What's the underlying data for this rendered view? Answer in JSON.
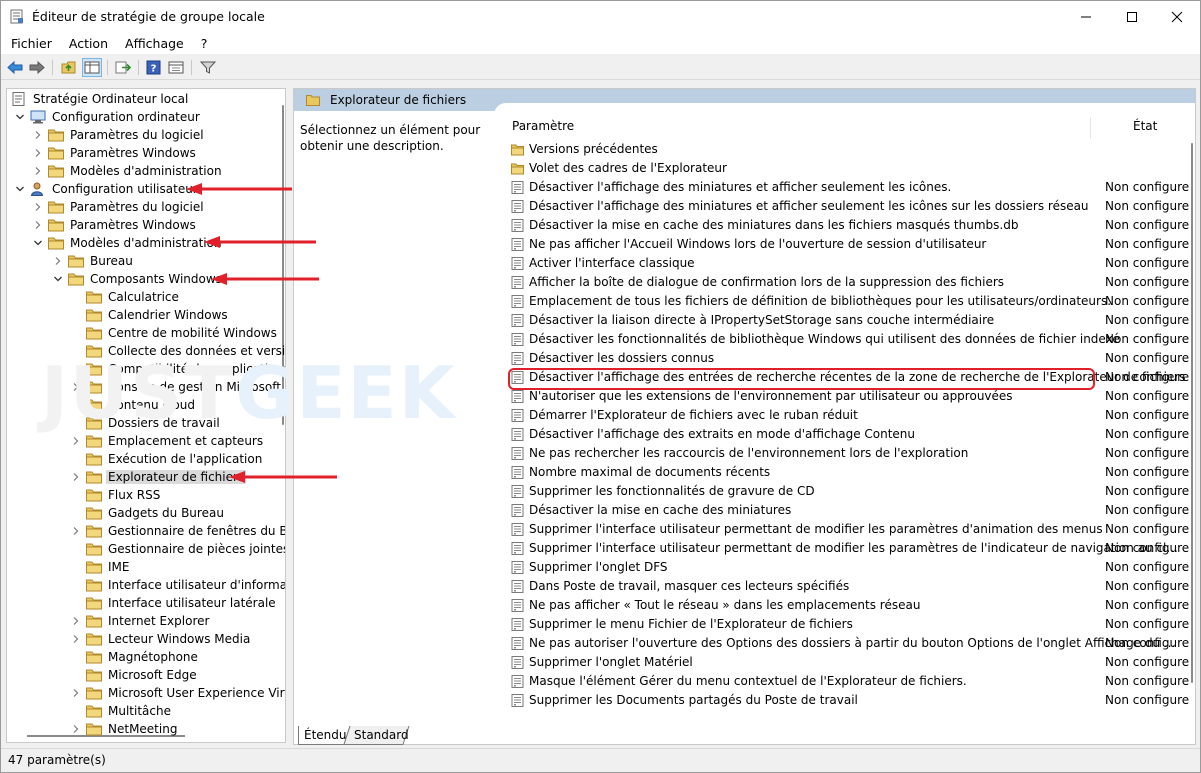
{
  "window": {
    "title": "Éditeur de stratégie de groupe locale",
    "menu": [
      "Fichier",
      "Action",
      "Affichage",
      "?"
    ]
  },
  "tree": [
    {
      "label": "Stratégie Ordinateur local",
      "indent": 0,
      "chev": "",
      "icon": "policy",
      "sel": false
    },
    {
      "label": "Configuration ordinateur",
      "indent": 1,
      "chev": "down",
      "icon": "computer",
      "sel": false
    },
    {
      "label": "Paramètres du logiciel",
      "indent": 2,
      "chev": "right",
      "icon": "folder",
      "sel": false
    },
    {
      "label": "Paramètres Windows",
      "indent": 2,
      "chev": "right",
      "icon": "folder",
      "sel": false
    },
    {
      "label": "Modèles d'administration",
      "indent": 2,
      "chev": "right",
      "icon": "folder",
      "sel": false
    },
    {
      "label": "Configuration utilisateur",
      "indent": 1,
      "chev": "down",
      "icon": "user",
      "sel": false
    },
    {
      "label": "Paramètres du logiciel",
      "indent": 2,
      "chev": "right",
      "icon": "folder",
      "sel": false
    },
    {
      "label": "Paramètres Windows",
      "indent": 2,
      "chev": "right",
      "icon": "folder",
      "sel": false
    },
    {
      "label": "Modèles d'administration",
      "indent": 2,
      "chev": "down",
      "icon": "folder",
      "sel": false
    },
    {
      "label": "Bureau",
      "indent": 3,
      "chev": "right",
      "icon": "folder",
      "sel": false
    },
    {
      "label": "Composants Windows",
      "indent": 3,
      "chev": "down",
      "icon": "folder",
      "sel": false
    },
    {
      "label": "Calculatrice",
      "indent": 4,
      "chev": "",
      "icon": "folder",
      "sel": false
    },
    {
      "label": "Calendrier Windows",
      "indent": 4,
      "chev": "",
      "icon": "folder",
      "sel": false
    },
    {
      "label": "Centre de mobilité Windows",
      "indent": 4,
      "chev": "",
      "icon": "folder",
      "sel": false
    },
    {
      "label": "Collecte des données et version",
      "indent": 4,
      "chev": "",
      "icon": "folder",
      "sel": false
    },
    {
      "label": "Compatibilité des applications",
      "indent": 4,
      "chev": "",
      "icon": "folder",
      "sel": false
    },
    {
      "label": "Console de gestion Microsoft",
      "indent": 4,
      "chev": "right",
      "icon": "folder",
      "sel": false
    },
    {
      "label": "Contenu cloud",
      "indent": 4,
      "chev": "",
      "icon": "folder",
      "sel": false
    },
    {
      "label": "Dossiers de travail",
      "indent": 4,
      "chev": "",
      "icon": "folder",
      "sel": false
    },
    {
      "label": "Emplacement et capteurs",
      "indent": 4,
      "chev": "right",
      "icon": "folder",
      "sel": false
    },
    {
      "label": "Exécution de l'application",
      "indent": 4,
      "chev": "",
      "icon": "folder",
      "sel": false
    },
    {
      "label": "Explorateur de fichiers",
      "indent": 4,
      "chev": "right",
      "icon": "folder",
      "sel": true
    },
    {
      "label": "Flux RSS",
      "indent": 4,
      "chev": "",
      "icon": "folder",
      "sel": false
    },
    {
      "label": "Gadgets du Bureau",
      "indent": 4,
      "chev": "",
      "icon": "folder",
      "sel": false
    },
    {
      "label": "Gestionnaire de fenêtres du Bu",
      "indent": 4,
      "chev": "right",
      "icon": "folder",
      "sel": false
    },
    {
      "label": "Gestionnaire de pièces jointes",
      "indent": 4,
      "chev": "",
      "icon": "folder",
      "sel": false
    },
    {
      "label": "IME",
      "indent": 4,
      "chev": "",
      "icon": "folder",
      "sel": false
    },
    {
      "label": "Interface utilisateur d'informati",
      "indent": 4,
      "chev": "",
      "icon": "folder",
      "sel": false
    },
    {
      "label": "Interface utilisateur latérale",
      "indent": 4,
      "chev": "",
      "icon": "folder",
      "sel": false
    },
    {
      "label": "Internet Explorer",
      "indent": 4,
      "chev": "right",
      "icon": "folder",
      "sel": false
    },
    {
      "label": "Lecteur Windows Media",
      "indent": 4,
      "chev": "right",
      "icon": "folder",
      "sel": false
    },
    {
      "label": "Magnétophone",
      "indent": 4,
      "chev": "",
      "icon": "folder",
      "sel": false
    },
    {
      "label": "Microsoft Edge",
      "indent": 4,
      "chev": "",
      "icon": "folder",
      "sel": false
    },
    {
      "label": "Microsoft User Experience Virtu",
      "indent": 4,
      "chev": "right",
      "icon": "folder",
      "sel": false
    },
    {
      "label": "Multitâche",
      "indent": 4,
      "chev": "",
      "icon": "folder",
      "sel": false
    },
    {
      "label": "NetMeeting",
      "indent": 4,
      "chev": "right",
      "icon": "folder",
      "sel": false
    }
  ],
  "panel": {
    "header": "Explorateur de fichiers",
    "description": "Sélectionnez un élément pour obtenir une description.",
    "col_param": "Paramètre",
    "col_state": "État"
  },
  "settings": [
    {
      "name": "Versions précédentes",
      "state": "",
      "folder": true
    },
    {
      "name": "Volet des cadres de l'Explorateur",
      "state": "",
      "folder": true
    },
    {
      "name": "Désactiver l'affichage des miniatures et afficher seulement les icônes.",
      "state": "Non configure",
      "folder": false
    },
    {
      "name": "Désactiver l'affichage des miniatures et afficher seulement les icônes sur les dossiers réseau",
      "state": "Non configure",
      "folder": false
    },
    {
      "name": "Désactiver la mise en cache des miniatures dans les fichiers masqués thumbs.db",
      "state": "Non configure",
      "folder": false
    },
    {
      "name": "Ne pas afficher l'Accueil Windows lors de l'ouverture de session d'utilisateur",
      "state": "Non configure",
      "folder": false
    },
    {
      "name": "Activer l'interface classique",
      "state": "Non configure",
      "folder": false
    },
    {
      "name": "Afficher la boîte de dialogue de confirmation lors de la suppression des fichiers",
      "state": "Non configure",
      "folder": false
    },
    {
      "name": "Emplacement de tous les fichiers de définition de bibliothèques pour les utilisateurs/ordinateurs.",
      "state": "Non configure",
      "folder": false
    },
    {
      "name": "Désactiver la liaison directe à IPropertySetStorage sans couche intermédiaire",
      "state": "Non configure",
      "folder": false
    },
    {
      "name": "Désactiver les fonctionnalités de bibliothèque Windows qui utilisent des données de fichier indexé",
      "state": "Non configure",
      "folder": false
    },
    {
      "name": "Désactiver les dossiers connus",
      "state": "Non configure",
      "folder": false
    },
    {
      "name": "Désactiver l'affichage des entrées de recherche récentes de la zone de recherche de l'Explorateur de fichiers",
      "state": "Non configure",
      "folder": false
    },
    {
      "name": "N'autoriser que les extensions de l'environnement par utilisateur ou approuvées",
      "state": "Non configure",
      "folder": false
    },
    {
      "name": "Démarrer l'Explorateur de fichiers avec le ruban réduit",
      "state": "Non configure",
      "folder": false
    },
    {
      "name": "Désactiver l'affichage des extraits en mode d'affichage Contenu",
      "state": "Non configure",
      "folder": false
    },
    {
      "name": "Ne pas rechercher les raccourcis de l'environnement lors de l'exploration",
      "state": "Non configure",
      "folder": false
    },
    {
      "name": "Nombre maximal de documents récents",
      "state": "Non configure",
      "folder": false
    },
    {
      "name": "Supprimer les fonctionnalités de gravure de CD",
      "state": "Non configure",
      "folder": false
    },
    {
      "name": "Désactiver la mise en cache des miniatures",
      "state": "Non configure",
      "folder": false
    },
    {
      "name": "Supprimer l'interface utilisateur permettant de modifier les paramètres d'animation des menus",
      "state": "Non configure",
      "folder": false
    },
    {
      "name": "Supprimer l'interface utilisateur permettant de modifier les paramètres de l'indicateur de navigation au cl...",
      "state": "Non configure",
      "folder": false
    },
    {
      "name": "Supprimer l'onglet DFS",
      "state": "Non configure",
      "folder": false
    },
    {
      "name": "Dans Poste de travail, masquer ces lecteurs spécifiés",
      "state": "Non configure",
      "folder": false
    },
    {
      "name": "Ne pas afficher « Tout le réseau » dans les emplacements réseau",
      "state": "Non configure",
      "folder": false
    },
    {
      "name": "Supprimer le menu Fichier de l'Explorateur de fichiers",
      "state": "Non configure",
      "folder": false
    },
    {
      "name": "Ne pas autoriser l'ouverture des Options des dossiers à partir du bouton Options de l'onglet Affichage du ...",
      "state": "Non configure",
      "folder": false
    },
    {
      "name": "Supprimer l'onglet Matériel",
      "state": "Non configure",
      "folder": false
    },
    {
      "name": "Masque l'élément Gérer du menu contextuel de l'Explorateur de fichiers.",
      "state": "Non configure",
      "folder": false
    },
    {
      "name": "Supprimer les Documents partagés du Poste de travail",
      "state": "Non configure",
      "folder": false
    }
  ],
  "highlight_index": 12,
  "tabs": [
    "Étendu",
    "Standard"
  ],
  "status": "47 paramètre(s)",
  "watermark": {
    "part1": "JUST",
    "part2": "GEEK"
  },
  "colors": {
    "accent_red": "#e0212b",
    "folder": "#e8c660",
    "header_bg": "#bccfe2"
  }
}
